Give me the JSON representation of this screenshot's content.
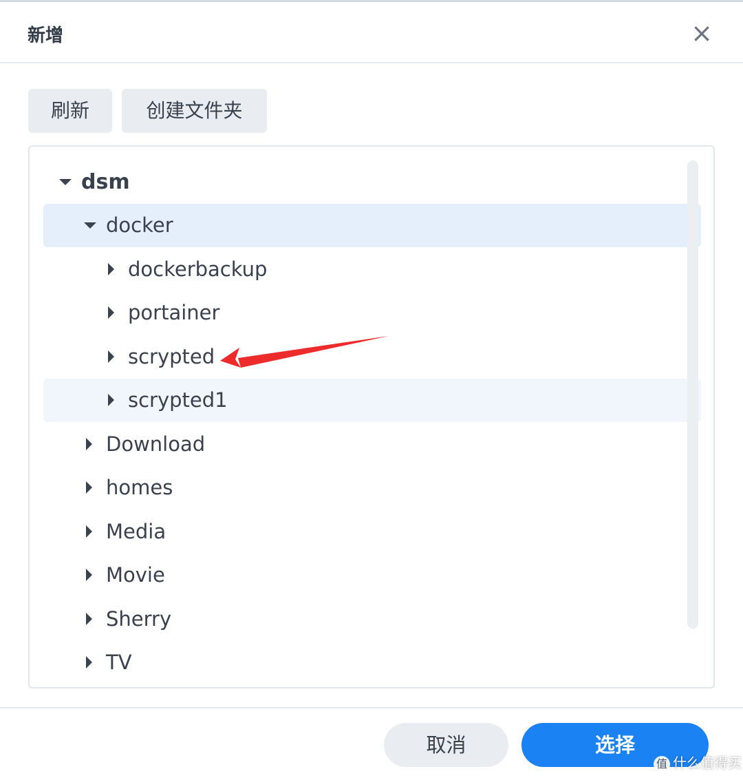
{
  "dialog": {
    "title": "新增",
    "close_icon": "×"
  },
  "toolbar": {
    "refresh_label": "刷新",
    "create_folder_label": "创建文件夹"
  },
  "tree": {
    "root": {
      "label": "dsm",
      "expanded": true
    },
    "items": [
      {
        "label": "docker",
        "expanded": true,
        "state": "selected"
      },
      {
        "label": "dockerbackup",
        "expanded": false
      },
      {
        "label": "portainer",
        "expanded": false
      },
      {
        "label": "scrypted",
        "expanded": false
      },
      {
        "label": "scrypted1",
        "expanded": false,
        "state": "hover"
      },
      {
        "label": "Download",
        "expanded": false
      },
      {
        "label": "homes",
        "expanded": false
      },
      {
        "label": "Media",
        "expanded": false
      },
      {
        "label": "Movie",
        "expanded": false
      },
      {
        "label": "Sherry",
        "expanded": false
      },
      {
        "label": "TV",
        "expanded": false
      }
    ]
  },
  "footer": {
    "cancel_label": "取消",
    "select_label": "选择"
  },
  "watermark": {
    "icon": "值",
    "text": "什么值得买"
  },
  "colors": {
    "accent": "#1a82f2",
    "selected_row": "#e4effb",
    "annotation_arrow": "#ee2b2b"
  }
}
